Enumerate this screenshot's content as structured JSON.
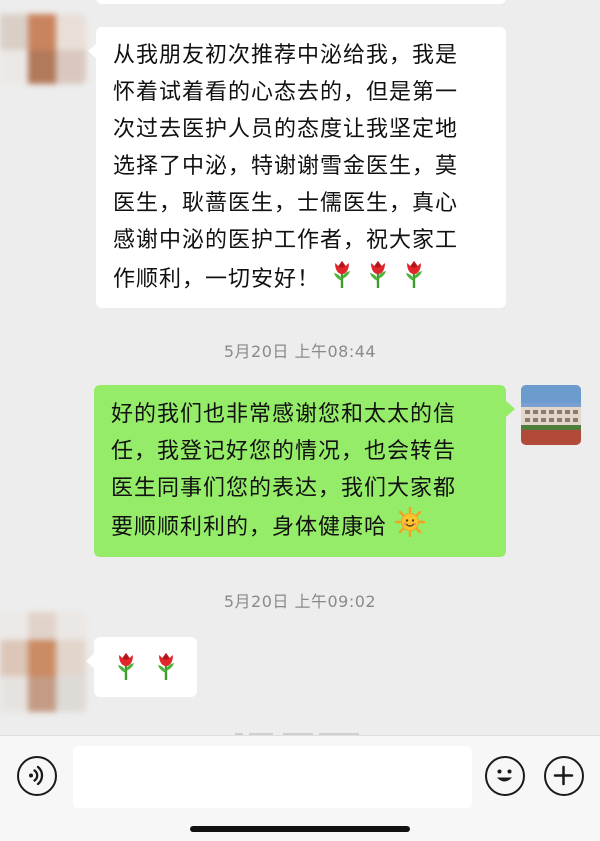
{
  "messages": [
    {
      "sender": "contact",
      "lines": [
        "从我朋友初次推荐中泌给我，我是",
        "怀着试着看的心态去的，但是第一",
        "次过去医护人员的态度让我坚定地",
        "选择了中泌，特谢谢雪金医生，莫",
        "医生，耿蔷医生，士儒医生，真心",
        "感谢中泌的医护工作者，祝大家工",
        "作顺利，一切安好！"
      ],
      "emoji_trailing": [
        "rose-icon",
        "rose-icon",
        "rose-icon"
      ]
    },
    {
      "timestamp": "5月20日 上午08:44"
    },
    {
      "sender": "me",
      "lines": [
        "好的我们也非常感谢您和太太的信",
        "任，我登记好您的情况，也会转告",
        "医生同事们您的表达，我们大家都",
        "要顺顺利利的，身体健康哈"
      ],
      "emoji_trailing": [
        "sun-smile-icon"
      ]
    },
    {
      "timestamp": "5月20日 上午09:02"
    },
    {
      "sender": "contact",
      "lines": [],
      "emoji_trailing": [
        "rose-icon",
        "rose-icon"
      ]
    }
  ],
  "input_bar": {
    "voice_icon": "voice-icon",
    "emoji_icon": "smiley-icon",
    "plus_icon": "plus-icon",
    "text_value": ""
  },
  "colors": {
    "background": "#ededed",
    "bubble_incoming": "#ffffff",
    "bubble_outgoing": "#95ec69",
    "timestamp_text": "#8a8a8a"
  }
}
